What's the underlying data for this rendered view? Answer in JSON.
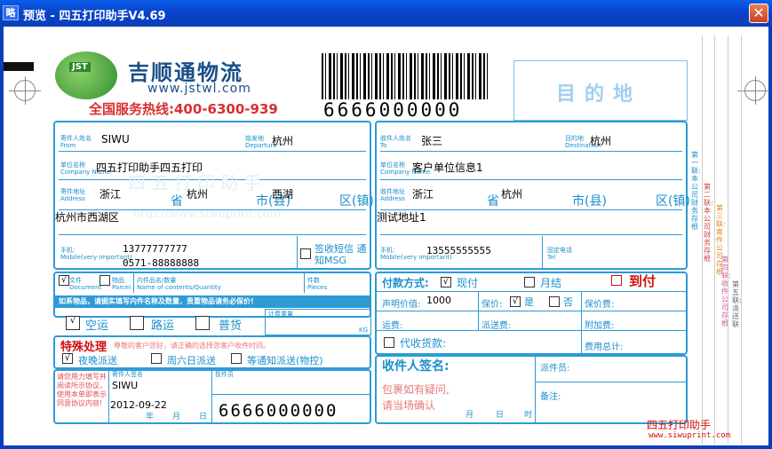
{
  "window": {
    "title": "预览 - 四五打印助手V4.69",
    "icon": "app-icon"
  },
  "company": {
    "name": "吉顺通物流",
    "website": "www.jstwl.com",
    "hotline": "全国服务热线:400-6300-939",
    "logo_text": "JST"
  },
  "barcode": {
    "number": "6666000000"
  },
  "destination": {
    "label": "目的地"
  },
  "sender": {
    "name_label": "寄件人姓名",
    "name_label_en": "From",
    "name": "SIWU",
    "origin_label": "始发地",
    "origin_label_en": "Departure",
    "origin": "杭州",
    "company_label": "单位名称",
    "company_label_en": "Company Name",
    "company": "四五打印助手四五打印",
    "address_label": "寄件地址",
    "address_label_en": "Address",
    "province": "浙江",
    "city": "杭州",
    "district": "西湖",
    "province_suffix": "省",
    "city_suffix": "市(县)",
    "district_suffix": "区(镇)",
    "address_detail": "杭州市西湖区",
    "phone_label": "手机:",
    "phone_label_en": "Mobile(very important)",
    "mobile": "13777777777",
    "tel": "0571-88888888",
    "sms_label": "签收短信 通知MSG",
    "watermark": "四五打印助手",
    "watermark_url": "http://www.siwuprint.com"
  },
  "receiver": {
    "name_label": "收件人姓名",
    "name_label_en": "To",
    "name": "张三",
    "dest_label": "目的地",
    "dest_label_en": "Destination",
    "dest": "杭州",
    "company_label": "单位名称",
    "company_label_en": "Company Name",
    "company": "客户单位信息1",
    "address_label": "收件地址",
    "address_label_en": "Address",
    "province": "浙江",
    "city": "杭州",
    "province_suffix": "省",
    "city_suffix": "市(县)",
    "district_suffix": "区(镇)",
    "address_detail": "测试地址1",
    "phone_label": "手机:",
    "phone_label_en": "Mobile(very important)",
    "mobile": "13555555555",
    "tel_label": "固定电话",
    "tel_label_en": "Tel"
  },
  "goods": {
    "doc_label": "文件",
    "doc_label_en": "Document",
    "doc_checked": "√",
    "parcel_label": "物品",
    "parcel_label_en": "Parcel",
    "content_label": "内件品名/数量",
    "content_label_en": "Name of contents/Quantity",
    "pieces_label": "件数",
    "pieces_label_en": "Pieces",
    "notice": "如系物品，请据实填写内件名称及数量，贵重物品请务必保价!"
  },
  "transport": {
    "air_label": "空运",
    "air_checked": "√",
    "road_label": "路运",
    "normal_label": "普货",
    "weight_label": "计费重量",
    "weight_unit": "KG"
  },
  "special": {
    "title": "特殊处理",
    "note": "尊敬的客户您好，请正确的选择您客户收件时间。",
    "night_label": "夜晚派送",
    "night_checked": "√",
    "weekend_label": "周六日派送",
    "wait_label": "等通知派送(物控)"
  },
  "payment": {
    "label": "付款方式:",
    "cash_label": "现付",
    "cash_checked": "√",
    "monthly_label": "月结",
    "cod_label": "到付",
    "declared_label": "声明价值:",
    "declared_value": "1000",
    "insured_label": "保价:",
    "insured_yes": "是",
    "insured_yes_checked": "√",
    "insured_no": "否",
    "insure_fee_label": "保价费:",
    "freight_label": "运费:",
    "delivery_fee_label": "派送费:",
    "extra_fee_label": "附加费:",
    "collect_label": "代收货款:",
    "total_label": "费用总计:"
  },
  "signature": {
    "sender_sign_label": "寄件人签名",
    "sender_sign": "SIWU",
    "date": "2012-09-22",
    "year": "年",
    "month": "月",
    "day": "日",
    "handler_label": "揽件员",
    "receiver_sign_label": "收件人签名:",
    "receiver_note1": "包裹如有疑问,",
    "receiver_note2": "请当场确认",
    "time_label": "时",
    "courier_label": "派件员:",
    "remark_label": "备注:",
    "barcode_number": "6666000000",
    "notice_text": "请您用力填写并阅读所示协议，使用本单即表示同意协议内容!"
  },
  "side_labels": [
    "第一联:本公司财务存根",
    "第二联:本公司财务存根",
    "第三联:寄件公司存根",
    "第四联:收件公司存根",
    "第五联:派送联"
  ],
  "footer": {
    "brand": "四五打印助手",
    "url": "www.siwuprint.com"
  }
}
